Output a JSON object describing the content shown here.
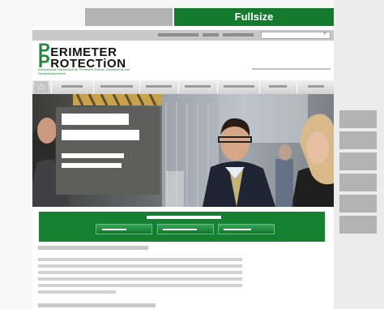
{
  "tabs": {
    "inactive_label": "",
    "active_label": "Fullsize"
  },
  "site": {
    "logo_line1_cap": "P",
    "logo_line1_rest": "ERIMETER",
    "logo_line2_cap": "P",
    "logo_line2_rest": "ROTECTiON",
    "tagline": "International Fachmesse für Perimeter-Schutz, Zauntechnik und Gebäudesicherheit"
  },
  "search": {
    "icon": "search-icon"
  },
  "nav": {
    "home_icon": "home-icon"
  },
  "colors": {
    "brand_green": "#168032",
    "tab_green": "#147a2e",
    "placeholder_gray": "#b4b4b4"
  }
}
